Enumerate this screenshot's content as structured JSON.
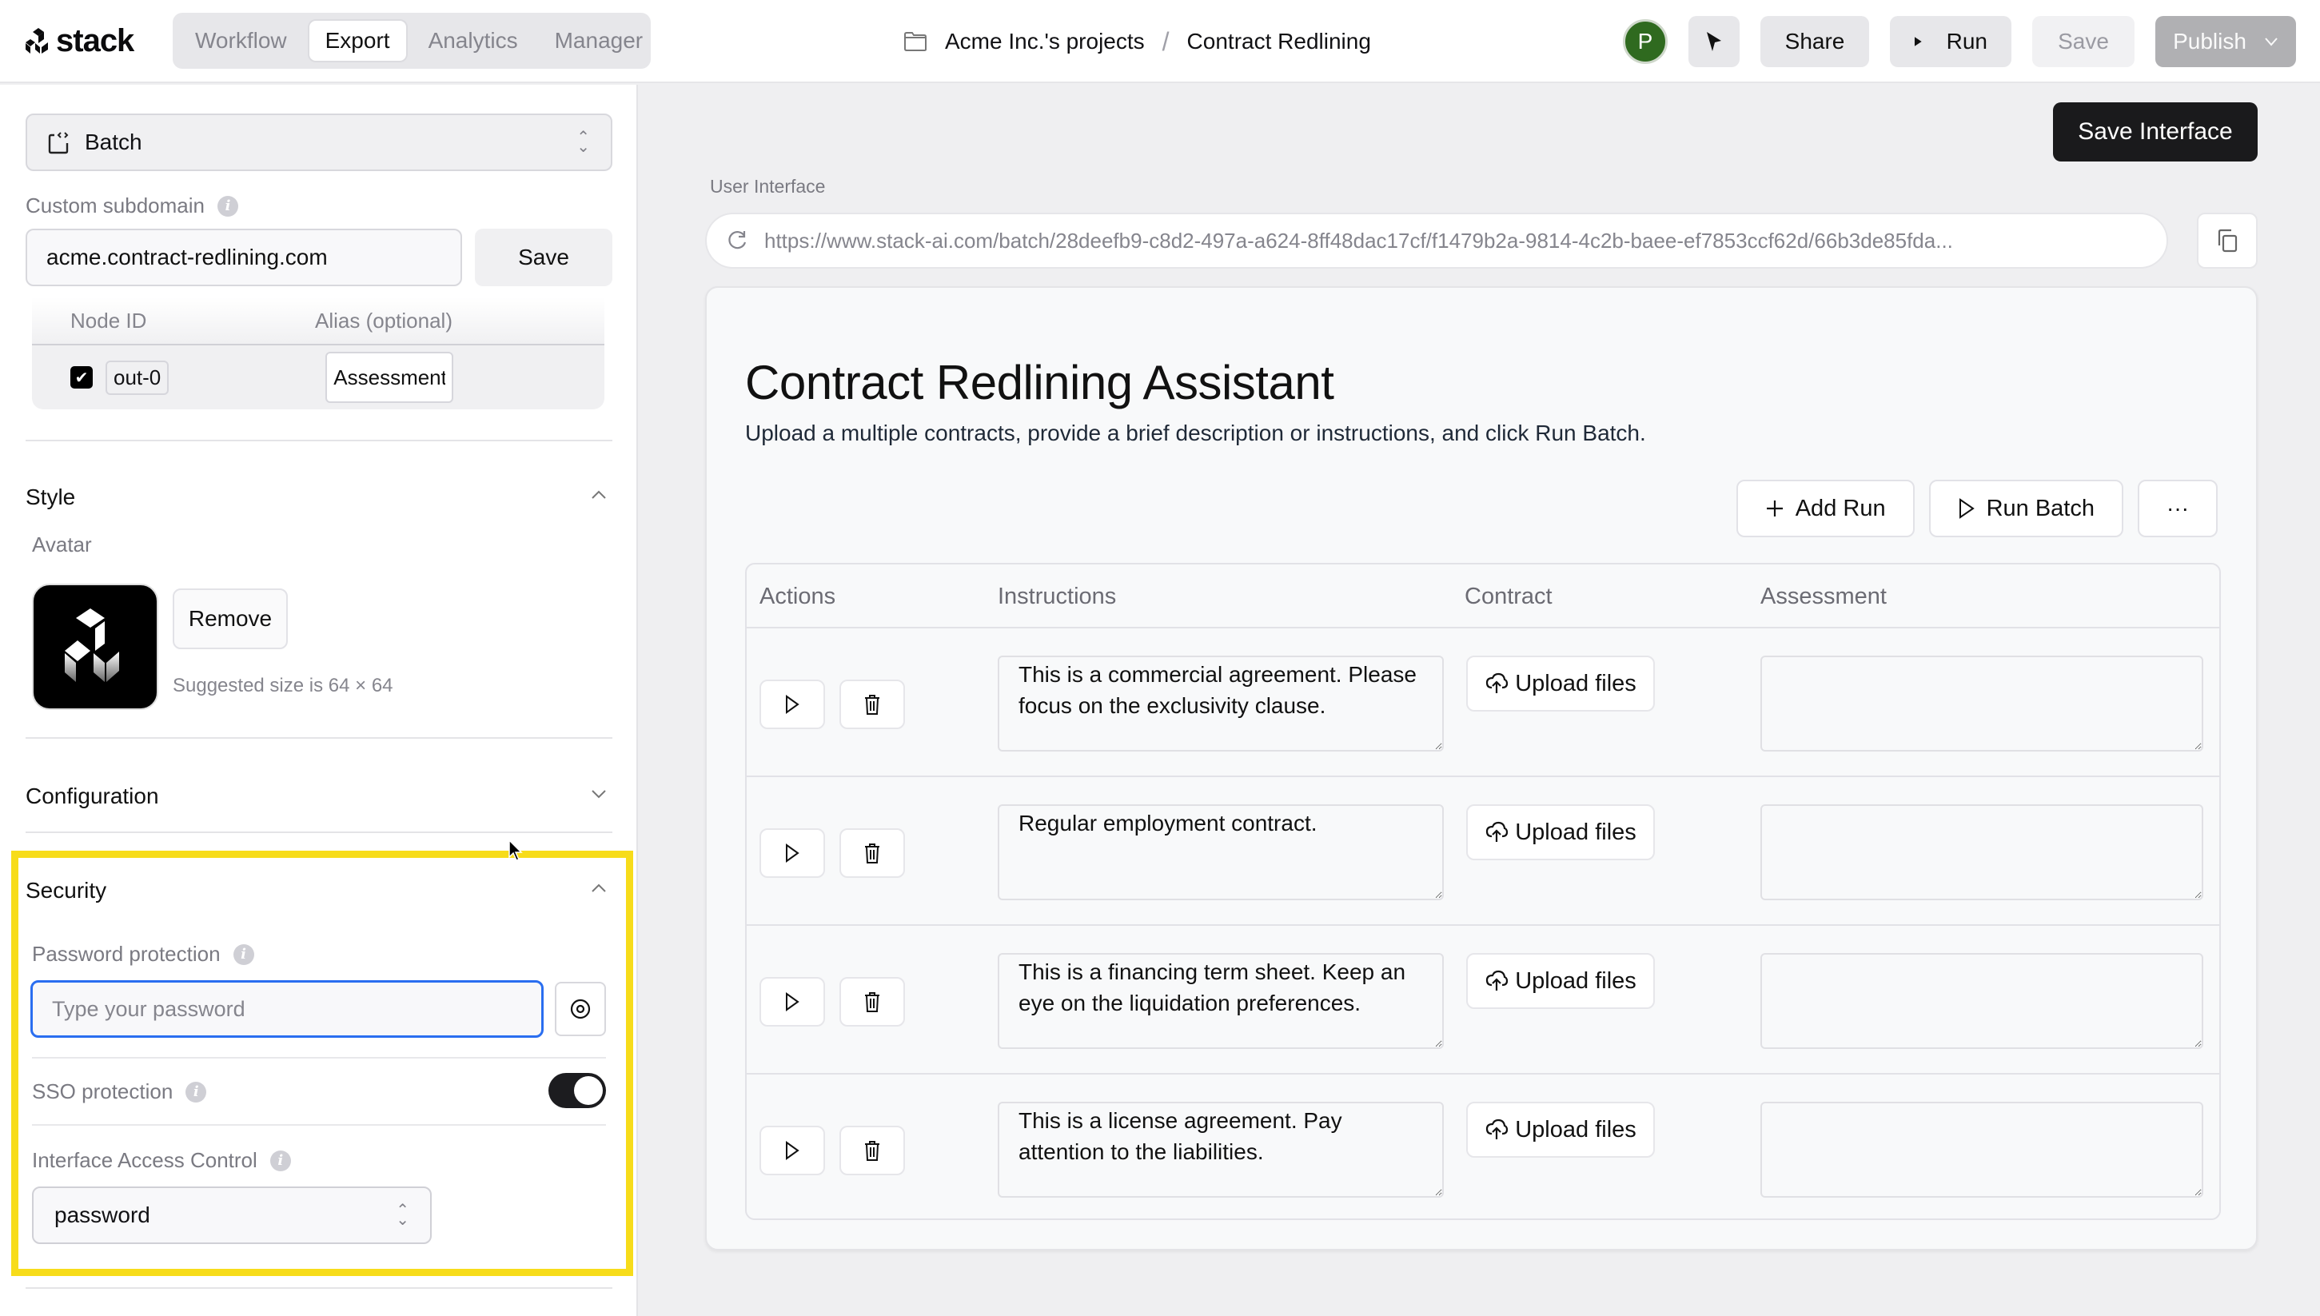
{
  "app": {
    "brand": "stack",
    "nav_tabs": [
      {
        "label": "Workflow",
        "active": false
      },
      {
        "label": "Export",
        "active": true
      },
      {
        "label": "Analytics",
        "active": false
      },
      {
        "label": "Manager",
        "active": false
      }
    ],
    "breadcrumb": {
      "icon": "folder-icon",
      "project": "Acme Inc.'s projects",
      "separator": "/",
      "current": "Contract Redlining"
    },
    "user_initial": "P",
    "actions": {
      "share": "Share",
      "run": "Run",
      "save": "Save",
      "publish": "Publish"
    }
  },
  "left_panel": {
    "interface_type": "Batch",
    "custom_subdomain": {
      "label": "Custom subdomain",
      "value": "acme.contract-redlining.com",
      "save_label": "Save"
    },
    "node_table": {
      "headers": [
        "Node ID",
        "Alias (optional)"
      ],
      "rows": [
        {
          "checked": true,
          "node_id": "out-0",
          "alias": "Assessment"
        }
      ]
    },
    "style": {
      "title": "Style",
      "expanded": true,
      "avatar_label": "Avatar",
      "remove_label": "Remove",
      "hint": "Suggested size is 64 × 64"
    },
    "configuration": {
      "title": "Configuration",
      "expanded": false
    },
    "security": {
      "title": "Security",
      "expanded": true,
      "password_label": "Password protection",
      "password_placeholder": "Type your password",
      "password_value": "",
      "sso_label": "SSO protection",
      "sso_enabled": true,
      "access_label": "Interface Access Control",
      "access_value": "password"
    }
  },
  "main": {
    "save_interface_label": "Save Interface",
    "ui_label": "User Interface",
    "url": "https://www.stack-ai.com/batch/28deefb9-c8d2-497a-a624-8ff48dac17cf/f1479b2a-9814-4c2b-baee-ef7853ccf62d/66b3de85fda...",
    "preview": {
      "title": "Contract Redlining Assistant",
      "description": "Upload a multiple contracts, provide a brief description or instructions, and click Run Batch.",
      "add_run_label": "Add Run",
      "run_batch_label": "Run Batch",
      "more_label": "···",
      "columns": [
        "Actions",
        "Instructions",
        "Contract",
        "Assessment"
      ],
      "upload_label": "Upload files",
      "rows": [
        {
          "instructions": "This is a commercial agreement. Please focus on the exclusivity clause.",
          "assessment": ""
        },
        {
          "instructions": "Regular employment contract.",
          "assessment": ""
        },
        {
          "instructions": "This is a financing term sheet. Keep an eye on the liquidation preferences.",
          "assessment": ""
        },
        {
          "instructions": "This is a license agreement. Pay attention to the liabilities.",
          "assessment": ""
        }
      ]
    }
  },
  "colors": {
    "highlight": "#f7dc1a",
    "focus_ring": "#2a6ef0",
    "avatar_green": "#2f6a1f",
    "primary_dark": "#1a1a1c"
  }
}
